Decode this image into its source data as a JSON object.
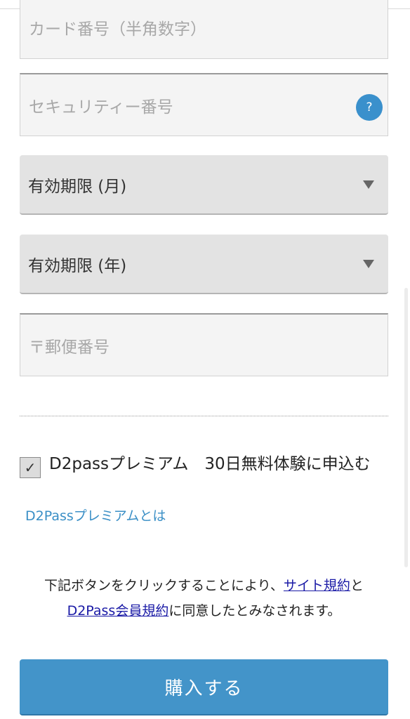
{
  "form": {
    "card_number_placeholder": "カード番号（半角数字）",
    "security_code_placeholder": "セキュリティー番号",
    "security_help_icon": "?",
    "expiry_month_label": "有効期限 (月)",
    "expiry_year_label": "有効期限 (年)",
    "postal_code_placeholder": "〒郵便番号"
  },
  "premium": {
    "checkbox_mark": "✓",
    "checked": true,
    "checkbox_label": "D2passプレミアム　30日無料体験に申込む",
    "info_link": "D2Passプレミアムとは"
  },
  "agreement": {
    "text_before": "下記ボタンをクリックすることにより、",
    "site_terms_link": "サイト規約",
    "text_and": "と",
    "member_terms_link": "D2Pass会員規約",
    "text_after": "に同意したとみなされます。"
  },
  "purchase_button": "購入する",
  "colors": {
    "accent_blue": "#4394c9",
    "link_blue": "#3a8fc6",
    "terms_link": "#1a1aa6"
  }
}
